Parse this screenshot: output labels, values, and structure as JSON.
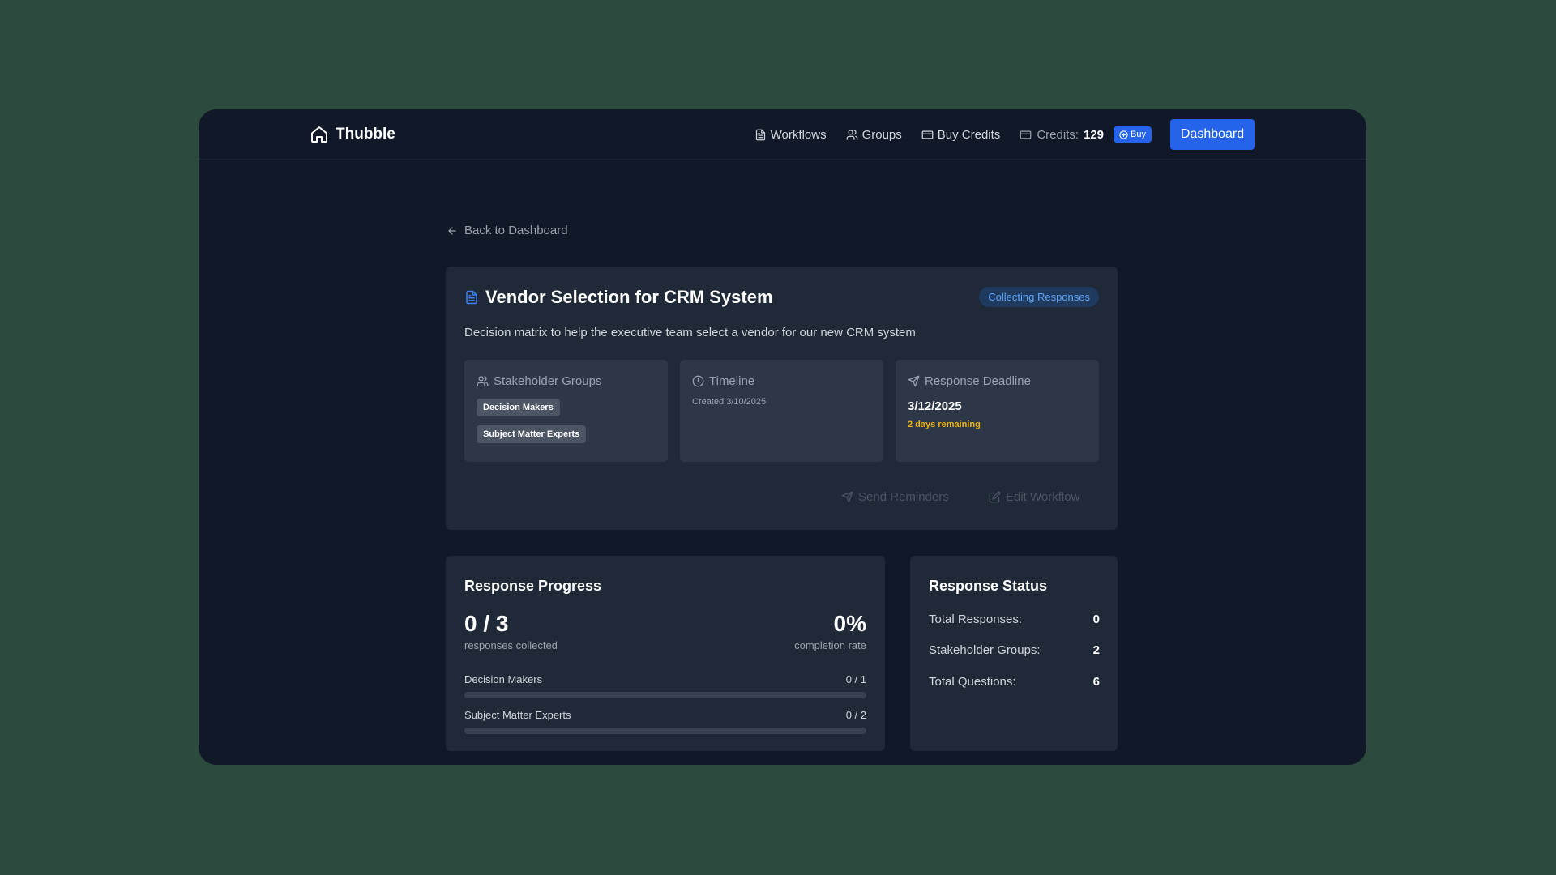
{
  "brand": {
    "name": "Thubble",
    "icon": "home-icon"
  },
  "nav": {
    "workflows": "Workflows",
    "groups": "Groups",
    "buy_credits": "Buy Credits",
    "credits_label": "Credits:",
    "credits_value": "129",
    "buy_label": "Buy",
    "dashboard": "Dashboard"
  },
  "back_link": "Back to Dashboard",
  "workflow": {
    "title": "Vendor Selection for CRM System",
    "status": "Collecting Responses",
    "description": "Decision matrix to help the executive team select a vendor for our new CRM system",
    "stakeholders": {
      "heading": "Stakeholder Groups",
      "tags": [
        "Decision Makers",
        "Subject Matter Experts"
      ]
    },
    "timeline": {
      "heading": "Timeline",
      "created": "Created 3/10/2025"
    },
    "deadline": {
      "heading": "Response Deadline",
      "date": "3/12/2025",
      "remaining": "2 days remaining"
    },
    "actions": {
      "send_reminders": "Send Reminders",
      "edit_workflow": "Edit Workflow"
    }
  },
  "progress": {
    "heading": "Response Progress",
    "collected": "0 / 3",
    "collected_label": "responses collected",
    "rate": "0%",
    "rate_label": "completion rate",
    "groups": [
      {
        "name": "Decision Makers",
        "value": "0 / 1",
        "fraction": 0
      },
      {
        "name": "Subject Matter Experts",
        "value": "0 / 2",
        "fraction": 0
      }
    ]
  },
  "status": {
    "heading": "Response Status",
    "rows": [
      {
        "label": "Total Responses:",
        "value": "0"
      },
      {
        "label": "Stakeholder Groups:",
        "value": "2"
      },
      {
        "label": "Total Questions:",
        "value": "6"
      }
    ]
  },
  "colors": {
    "page_bg": "#2c4a3e",
    "app_bg": "#111827",
    "card_bg": "#1f2937",
    "accent": "#2563eb",
    "warning": "#eab308"
  }
}
